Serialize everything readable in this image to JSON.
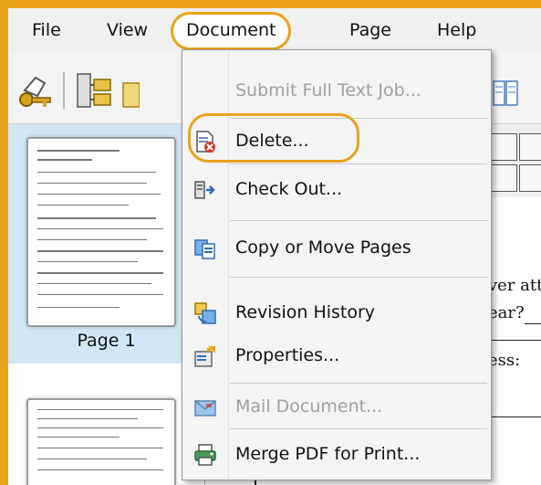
{
  "menubar": {
    "items": [
      {
        "label": "File"
      },
      {
        "label": "View"
      },
      {
        "label": "Document"
      },
      {
        "label": "Page"
      },
      {
        "label": "Help"
      }
    ]
  },
  "thumbnails": [
    {
      "label": "Page 1"
    },
    {
      "label": ""
    }
  ],
  "document": {
    "line1": "ver atte",
    "line2": "ear?",
    "line3": "ess:"
  },
  "document_menu": {
    "items": [
      {
        "label": "Submit Full Text Job...",
        "icon": "none",
        "enabled": false
      },
      {
        "label": "Delete...",
        "icon": "delete-document-icon",
        "enabled": true
      },
      {
        "label": "Check Out...",
        "icon": "check-out-icon",
        "enabled": true
      },
      {
        "label": "Copy or Move Pages",
        "icon": "copy-pages-icon",
        "enabled": true
      },
      {
        "label": "Revision History",
        "icon": "revision-history-icon",
        "enabled": true
      },
      {
        "label": "Properties...",
        "icon": "properties-icon",
        "enabled": true
      },
      {
        "label": "Mail Document...",
        "icon": "mail-icon",
        "enabled": false
      },
      {
        "label": "Merge PDF for Print...",
        "icon": "printer-icon",
        "enabled": true
      }
    ]
  },
  "colors": {
    "highlight": "#e8a21c",
    "selection": "#d2e7f3"
  }
}
